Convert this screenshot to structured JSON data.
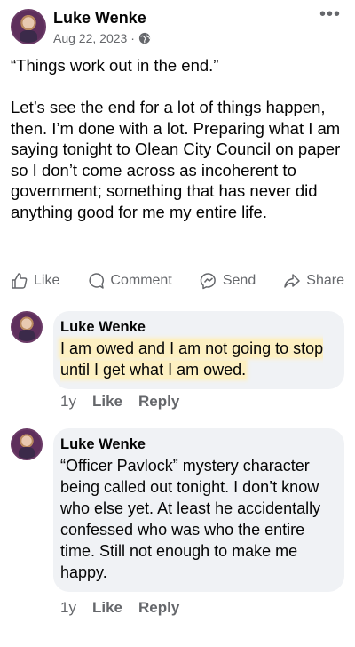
{
  "post": {
    "author": "Luke Wenke",
    "date": "Aug 22, 2023",
    "separator": "·",
    "privacy_icon": "globe-icon",
    "more_icon": "more-options-icon",
    "quote": "“Things work out in the end.”",
    "body": "Let’s see the end for a lot of things happen, then.  I’m done with a lot. Preparing what I am saying tonight to Olean City Council on paper so I don’t come across as incoherent to government; something that has never did anything good for me my entire life."
  },
  "actions": {
    "like": "Like",
    "comment": "Comment",
    "send": "Send",
    "share": "Share"
  },
  "comments": [
    {
      "author": "Luke Wenke",
      "text": "I am owed and I am not going to stop until I get what I am owed.",
      "time": "1y",
      "like": "Like",
      "reply": "Reply",
      "highlight_color": "#fdf0c2"
    },
    {
      "author": "Luke Wenke",
      "text": "“Officer Pavlock” mystery character being called out tonight. I don’t know who else yet.  At least he accidentally confessed who was who the entire time.  Still not enough to make me happy.",
      "time": "1y",
      "like": "Like",
      "reply": "Reply"
    }
  ],
  "colors": {
    "text": "#050505",
    "secondary": "#65676b",
    "bubble": "#f0f2f5"
  }
}
